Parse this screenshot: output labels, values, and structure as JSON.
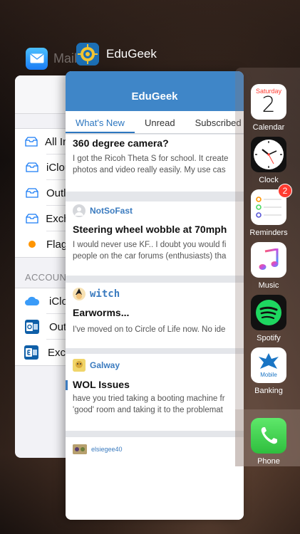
{
  "mail": {
    "title": "Mail",
    "mailboxes": [
      {
        "label": "All Inboxes",
        "icon": "tray-icon"
      },
      {
        "label": "iCloud",
        "icon": "tray-icon"
      },
      {
        "label": "Outlook",
        "icon": "tray-icon"
      },
      {
        "label": "Exchange",
        "icon": "tray-icon"
      },
      {
        "label": "Flagged",
        "icon": "flag-dot-icon"
      }
    ],
    "accounts_header": "ACCOUNTS",
    "accounts": [
      {
        "label": "iCloud",
        "icon": "icloud-icon"
      },
      {
        "label": "Outlook",
        "icon": "outlook-icon"
      },
      {
        "label": "Exchange",
        "icon": "exchange-icon"
      }
    ]
  },
  "edugeek": {
    "app_title": "EduGeek",
    "header_title": "EduGeek",
    "tabs": [
      "What's New",
      "Unread",
      "Subscribed"
    ],
    "active_tab": "What's New",
    "threads": [
      {
        "user": "",
        "title": "360 degree camera?",
        "snippet1": "I got the Ricoh Theta S for school. It create",
        "snippet2": "photos and video really easily. My use cas"
      },
      {
        "user": "NotSoFast",
        "title": "Steering wheel wobble at 70mph",
        "snippet1": "I would never use KF.. I doubt you would fi",
        "snippet2": "people on the car forums (enthusiasts) tha"
      },
      {
        "user": "witch",
        "title": "Earworms...",
        "snippet1": "I've moved on to Circle of Life now. No ide",
        "snippet2": ""
      },
      {
        "user": "Galway",
        "title": "WOL Issues",
        "snippet1": "have you tried taking a booting machine fr",
        "snippet2": "'good' room and taking it to the problemat"
      },
      {
        "user": "elsiegee40",
        "title": "",
        "snippet1": "",
        "snippet2": ""
      }
    ]
  },
  "dock": {
    "apps": [
      {
        "label": "Calendar",
        "day_name": "Saturday",
        "day_number": "2"
      },
      {
        "label": "Clock"
      },
      {
        "label": "Reminders",
        "badge": "2"
      },
      {
        "label": "Music"
      },
      {
        "label": "Spotify"
      },
      {
        "label": "Mobile\nBanking",
        "tile_text": "Mobile",
        "label_text": "Banking"
      },
      {
        "label": "Phone"
      }
    ]
  },
  "colors": {
    "edugeek_blue": "#3f86c8",
    "link_blue": "#3b7bbf",
    "badge_red": "#ff3b30"
  }
}
